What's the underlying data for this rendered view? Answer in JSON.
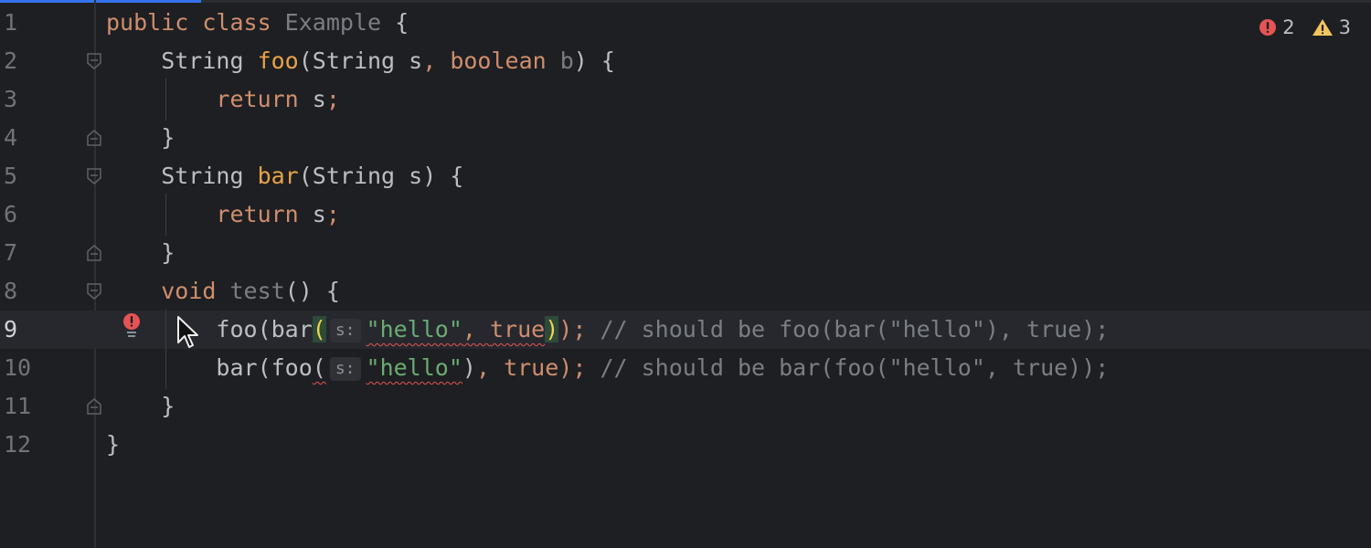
{
  "inspections": {
    "errors": "2",
    "warnings": "3",
    "colors": {
      "error": "#e55454",
      "warning": "#f2c55c"
    }
  },
  "lines": [
    {
      "n": "1",
      "segments": [
        {
          "t": "public class ",
          "c": "kw"
        },
        {
          "t": "Example",
          "c": "gray"
        },
        {
          "t": " {",
          "c": ""
        }
      ]
    },
    {
      "n": "2",
      "segments": [
        {
          "t": "    String ",
          "c": ""
        },
        {
          "t": "foo",
          "c": "fn"
        },
        {
          "t": "(String s",
          "c": ""
        },
        {
          "t": ", ",
          "c": "kw"
        },
        {
          "t": "boolean ",
          "c": "kw"
        },
        {
          "t": "b",
          "c": "gray"
        },
        {
          "t": ") {",
          "c": ""
        }
      ]
    },
    {
      "n": "3",
      "segments": [
        {
          "t": "        ",
          "c": ""
        },
        {
          "t": "return ",
          "c": "kw"
        },
        {
          "t": "s",
          "c": ""
        },
        {
          "t": ";",
          "c": "kw"
        }
      ]
    },
    {
      "n": "4",
      "segments": [
        {
          "t": "    }",
          "c": ""
        }
      ]
    },
    {
      "n": "5",
      "segments": [
        {
          "t": "    String ",
          "c": ""
        },
        {
          "t": "bar",
          "c": "fn"
        },
        {
          "t": "(String s) {",
          "c": ""
        }
      ]
    },
    {
      "n": "6",
      "segments": [
        {
          "t": "        ",
          "c": ""
        },
        {
          "t": "return ",
          "c": "kw"
        },
        {
          "t": "s",
          "c": ""
        },
        {
          "t": ";",
          "c": "kw"
        }
      ]
    },
    {
      "n": "7",
      "segments": [
        {
          "t": "    }",
          "c": ""
        }
      ]
    },
    {
      "n": "8",
      "segments": [
        {
          "t": "    ",
          "c": ""
        },
        {
          "t": "void ",
          "c": "kw"
        },
        {
          "t": "test",
          "c": "gray"
        },
        {
          "t": "() {",
          "c": ""
        }
      ]
    },
    {
      "n": "9",
      "current": true,
      "segments": [
        {
          "t": "        foo(bar",
          "c": ""
        },
        {
          "t": "(",
          "c": "brace"
        },
        {
          "t": "s:",
          "c": "hint"
        },
        {
          "t": "\"hello\"",
          "c": "str err"
        },
        {
          "t": ", ",
          "c": "kw err"
        },
        {
          "t": "true",
          "c": "kw err"
        },
        {
          "t": ")",
          "c": "brace"
        },
        {
          "t": ");",
          "c": "kw"
        },
        {
          "t": " // should be foo(bar(\"hello\"), true);",
          "c": "cmt"
        }
      ]
    },
    {
      "n": "10",
      "segments": [
        {
          "t": "        bar(foo",
          "c": ""
        },
        {
          "t": "(",
          "c": "err"
        },
        {
          "t": "s:",
          "c": "hint"
        },
        {
          "t": "\"hello\"",
          "c": "str err"
        },
        {
          "t": ")",
          "c": ""
        },
        {
          "t": ", ",
          "c": "kw"
        },
        {
          "t": "true",
          "c": "kw"
        },
        {
          "t": ");",
          "c": "kw"
        },
        {
          "t": " // should be bar(foo(\"hello\", true));",
          "c": "cmt"
        }
      ]
    },
    {
      "n": "11",
      "segments": [
        {
          "t": "    }",
          "c": ""
        }
      ]
    },
    {
      "n": "12",
      "segments": [
        {
          "t": "}",
          "c": ""
        }
      ]
    }
  ],
  "icons": {
    "error_stripe": "error-circle-icon",
    "warning_stripe": "warning-triangle-icon",
    "gutter_error": "error-bulb-icon",
    "pointer": "mouse-pointer-icon"
  }
}
